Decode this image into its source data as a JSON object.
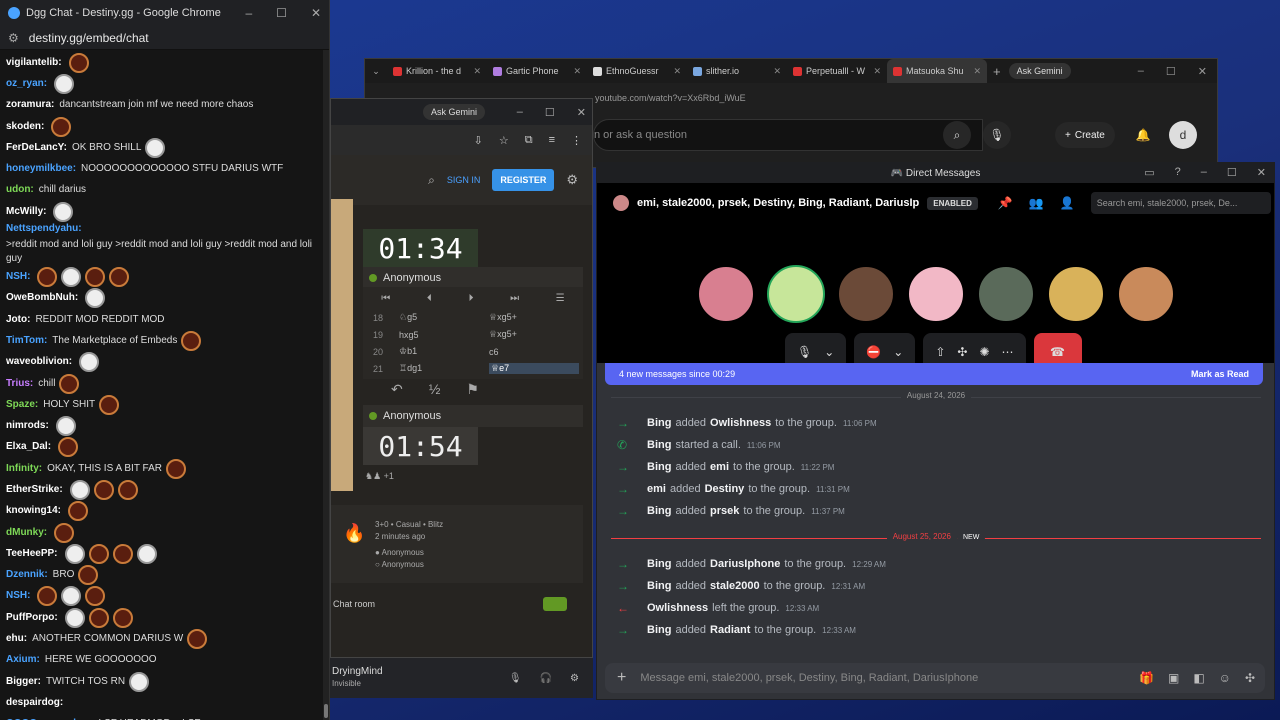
{
  "chat_window": {
    "title": "Dgg Chat - Destiny.gg - Google Chrome",
    "url": "destiny.gg/embed/chat",
    "lines": [
      {
        "user": "vigilantelib:",
        "color": "#ffffff",
        "text": "",
        "emotes": 1
      },
      {
        "user": "oz_ryan:",
        "color": "#4aa3ff",
        "text": "",
        "emotes": 1
      },
      {
        "user": "zoramura:",
        "color": "#ffffff",
        "text": "dancantstream join mf we need more chaos",
        "emotes": 0
      },
      {
        "user": "skoden:",
        "color": "#ffffff",
        "text": "",
        "emotes": 1
      },
      {
        "user": "FerDeLancY:",
        "color": "#ffffff",
        "text": "OK BRO SHILL",
        "emotes": 1
      },
      {
        "user": "honeymilkbee:",
        "color": "#4aa3ff",
        "text": "NOOOOOOOOOOOOO STFU DARIUS WTF",
        "emotes": 0
      },
      {
        "user": "udon:",
        "color": "#7ed957",
        "text": "chill darius",
        "emotes": 0
      },
      {
        "user": "McWilly:",
        "color": "#ffffff",
        "text": "",
        "emotes": 1
      },
      {
        "user": "Nettspendyahu:",
        "color": "#4aa3ff",
        "text": ">reddit mod and loli guy  >reddit mod and loli guy  >reddit mod and loli guy",
        "emotes": 0
      },
      {
        "user": "NSH:",
        "color": "#4aa3ff",
        "text": "",
        "emotes": 4
      },
      {
        "user": "OweBombNuh:",
        "color": "#ffffff",
        "text": "",
        "emotes": 1
      },
      {
        "user": "Joto:",
        "color": "#ffffff",
        "text": "REDDIT MOD  REDDIT MOD",
        "emotes": 0
      },
      {
        "user": "TimTom:",
        "color": "#4aa3ff",
        "text": "The Marketplace of Embeds",
        "emotes": 1
      },
      {
        "user": "waveoblivion:",
        "color": "#ffffff",
        "text": "",
        "emotes": 1
      },
      {
        "user": "Trius:",
        "color": "#c77dff",
        "text": "chill",
        "emotes": 1
      },
      {
        "user": "Spaze:",
        "color": "#7ed957",
        "text": "HOLY SHIT",
        "emotes": 1
      },
      {
        "user": "nimrods:",
        "color": "#ffffff",
        "text": "",
        "emotes": 1
      },
      {
        "user": "Elxa_Dal:",
        "color": "#ffffff",
        "text": "",
        "emotes": 1
      },
      {
        "user": "Infinity:",
        "color": "#7ed957",
        "text": "OKAY, THIS IS A BIT FAR",
        "emotes": 1
      },
      {
        "user": "EtherStrike:",
        "color": "#ffffff",
        "text": "",
        "emotes": 3
      },
      {
        "user": "knowing14:",
        "color": "#ffffff",
        "text": "",
        "emotes": 1
      },
      {
        "user": "dMunky:",
        "color": "#7ed957",
        "text": "",
        "emotes": 1
      },
      {
        "user": "TeeHeePP:",
        "color": "#ffffff",
        "text": "",
        "emotes": 4
      },
      {
        "user": "Dzennik:",
        "color": "#4aa3ff",
        "text": "BRO",
        "emotes": 1
      },
      {
        "user": "NSH:",
        "color": "#4aa3ff",
        "text": "",
        "emotes": 3
      },
      {
        "user": "PuffPorpo:",
        "color": "#ffffff",
        "text": "",
        "emotes": 3
      },
      {
        "user": "ehu:",
        "color": "#ffffff",
        "text": "ANOTHER COMMON DARIUS W",
        "emotes": 1
      },
      {
        "user": "Axium:",
        "color": "#4aa3ff",
        "text": "HERE WE GOOOOOOO",
        "emotes": 0
      },
      {
        "user": "Bigger:",
        "color": "#ffffff",
        "text": "TWITCH TOS RN",
        "emotes": 1
      },
      {
        "user": "despairdog:",
        "color": "#ffffff",
        "text": "",
        "emotes": 0
      },
      {
        "user": "OOOOvernanda:",
        "color": "#4aa3ff",
        "text": ">  LSF HEADMOD >  LSF",
        "emotes": 0
      }
    ]
  },
  "browser": {
    "tabs": [
      "Krillion - the d",
      "Gartic Phone",
      "EthnoGuessr",
      "slither.io",
      "Perpetualll - W",
      "Matsuoka Shu"
    ],
    "gemini": "Ask Gemini",
    "address": "youtube.com/watch?v=Xx6Rbd_iWuE",
    "search_placeholder": "n or ask a question",
    "create_label": "Create",
    "avatar_letter": "d"
  },
  "lichess": {
    "gemini": "Ask Gemini",
    "sign_in": "SIGN IN",
    "register": "REGISTER",
    "top_clock": "01:34",
    "bottom_clock": "01:54",
    "top_player": "Anonymous",
    "bottom_player": "Anonymous",
    "moves": [
      {
        "n": "18",
        "w": "♘g5",
        "b": "♕xg5+"
      },
      {
        "n": "19",
        "w": "hxg5",
        "b": "♕xg5+"
      },
      {
        "n": "20",
        "w": "♔b1",
        "b": "c6"
      },
      {
        "n": "21",
        "w": "♖dg1",
        "b": "♕e7"
      }
    ],
    "captured": "+1",
    "game_type": "3+0 • Casual • Blitz",
    "game_time": "2 minutes ago",
    "white": "Anonymous",
    "black": "Anonymous",
    "chat_room": "Chat room"
  },
  "discord_bar": {
    "user": "DryingMind",
    "status": "Invisible"
  },
  "dm": {
    "window_title": "Direct Messages",
    "group_name": "emi, stale2000, prsek, Destiny, Bing, Radiant, DariusIp",
    "enabled_badge": "ENABLED",
    "search_placeholder": "Search emi, stale2000, prsek, De...",
    "new_messages": "4 new messages since 00:29",
    "mark_read": "Mark as Read",
    "date1": "August 24, 2026",
    "date2": "August 25, 2026",
    "new_tag": "NEW",
    "messages": [
      {
        "actor": "Bing",
        "verb": "added",
        "target": "Owlishness",
        "rest": "to the group.",
        "ts": "11:06 PM",
        "kind": "join"
      },
      {
        "actor": "Bing",
        "verb": "started a call.",
        "target": "",
        "rest": "",
        "ts": "11:06 PM",
        "kind": "call"
      },
      {
        "actor": "Bing",
        "verb": "added",
        "target": "emi",
        "rest": "to the group.",
        "ts": "11:22 PM",
        "kind": "join"
      },
      {
        "actor": "emi",
        "verb": "added",
        "target": "Destiny",
        "rest": "to the group.",
        "ts": "11:31 PM",
        "kind": "join"
      },
      {
        "actor": "Bing",
        "verb": "added",
        "target": "prsek",
        "rest": "to the group.",
        "ts": "11:37 PM",
        "kind": "join"
      },
      {
        "actor": "Bing",
        "verb": "added",
        "target": "DariusIphone",
        "rest": "to the group.",
        "ts": "12:29 AM",
        "kind": "join"
      },
      {
        "actor": "Bing",
        "verb": "added",
        "target": "stale2000",
        "rest": "to the group.",
        "ts": "12:31 AM",
        "kind": "join"
      },
      {
        "actor": "Owlishness",
        "verb": "left the group.",
        "target": "",
        "rest": "",
        "ts": "12:33 AM",
        "kind": "leave"
      },
      {
        "actor": "Bing",
        "verb": "added",
        "target": "Radiant",
        "rest": "to the group.",
        "ts": "12:33 AM",
        "kind": "join"
      }
    ],
    "composer_placeholder": "Message emi, stale2000, prsek, Destiny, Bing, Radiant, DariusIphone",
    "avatar_colors": [
      "#d87f90",
      "#c7e69a",
      "#6b4a38",
      "#f2b8c6",
      "#5a6a5a",
      "#d9b25a",
      "#c98a5b"
    ]
  }
}
